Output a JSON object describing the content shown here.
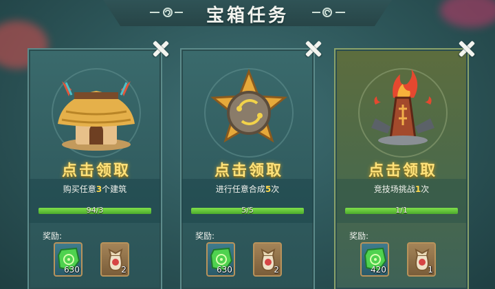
{
  "header": {
    "title": "宝箱任务"
  },
  "cards": [
    {
      "claim_label": "点击领取",
      "task_prefix": "购买任意",
      "task_number": "3",
      "task_suffix": "个建筑",
      "progress_text": "94/3",
      "progress_fraction": 1.0,
      "reward_label": "奖励:",
      "rewards": [
        {
          "icon": "green-gem-icon",
          "count": "630"
        },
        {
          "icon": "loot-bag-icon",
          "count": "2"
        }
      ],
      "image_icon": "straw-hut-icon"
    },
    {
      "claim_label": "点击领取",
      "task_prefix": "进行任意合成",
      "task_number": "5",
      "task_suffix": "次",
      "progress_text": "5/5",
      "progress_fraction": 1.0,
      "reward_label": "奖励:",
      "rewards": [
        {
          "icon": "green-gem-icon",
          "count": "630"
        },
        {
          "icon": "loot-bag-icon",
          "count": "2"
        }
      ],
      "image_icon": "merge-star-medal-icon"
    },
    {
      "claim_label": "点击领取",
      "task_prefix": "竞技场挑战",
      "task_number": "1",
      "task_suffix": "次",
      "progress_text": "1/1",
      "progress_fraction": 1.0,
      "reward_label": "奖励:",
      "rewards": [
        {
          "icon": "green-gem-icon",
          "count": "420"
        },
        {
          "icon": "loot-bag-icon",
          "count": "1"
        }
      ],
      "image_icon": "flaming-totem-icon"
    }
  ],
  "colors": {
    "claim_text": "#ffe27a",
    "progress_fill": "#6fd13e",
    "task_number": "#ffd84a"
  }
}
